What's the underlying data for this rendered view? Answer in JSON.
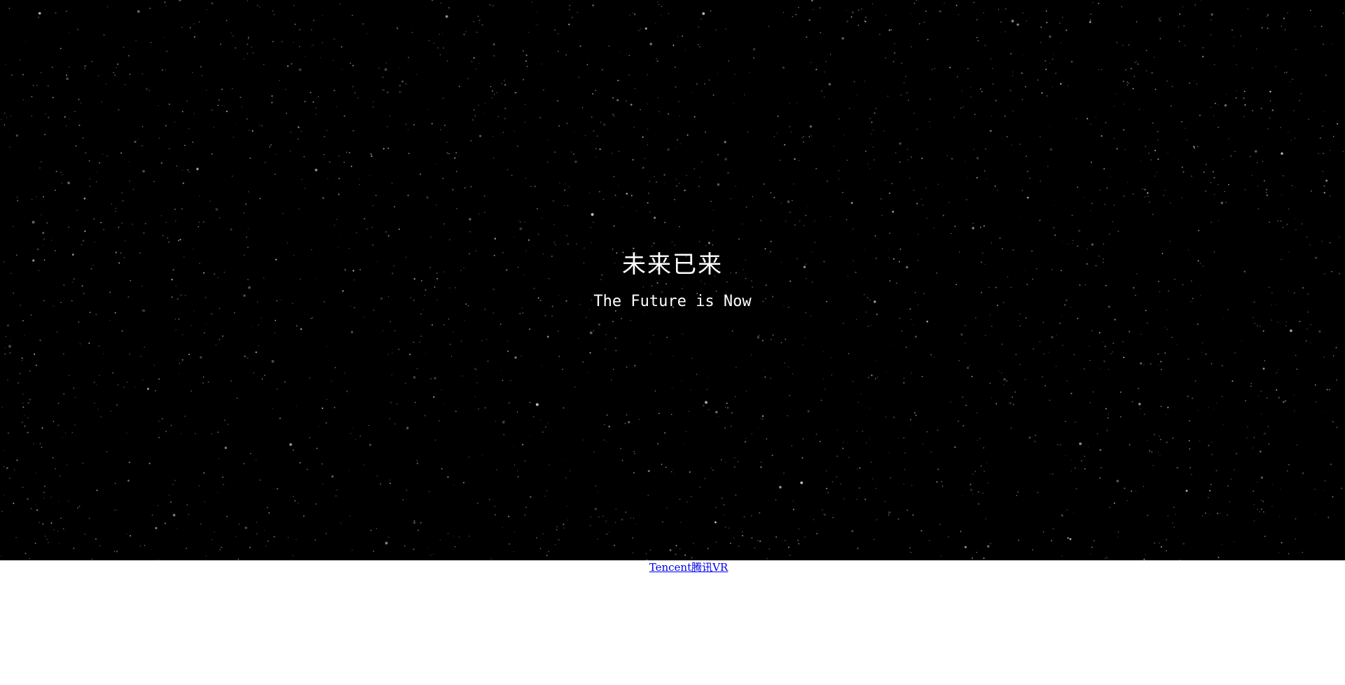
{
  "hero": {
    "title": "未来已来",
    "subtitle": "The Future is Now",
    "background_color": "#000000",
    "text_color": "#ffffff"
  },
  "footer": {
    "link_text": "Tencent腾讯VR",
    "link_color": "#0000ee"
  }
}
